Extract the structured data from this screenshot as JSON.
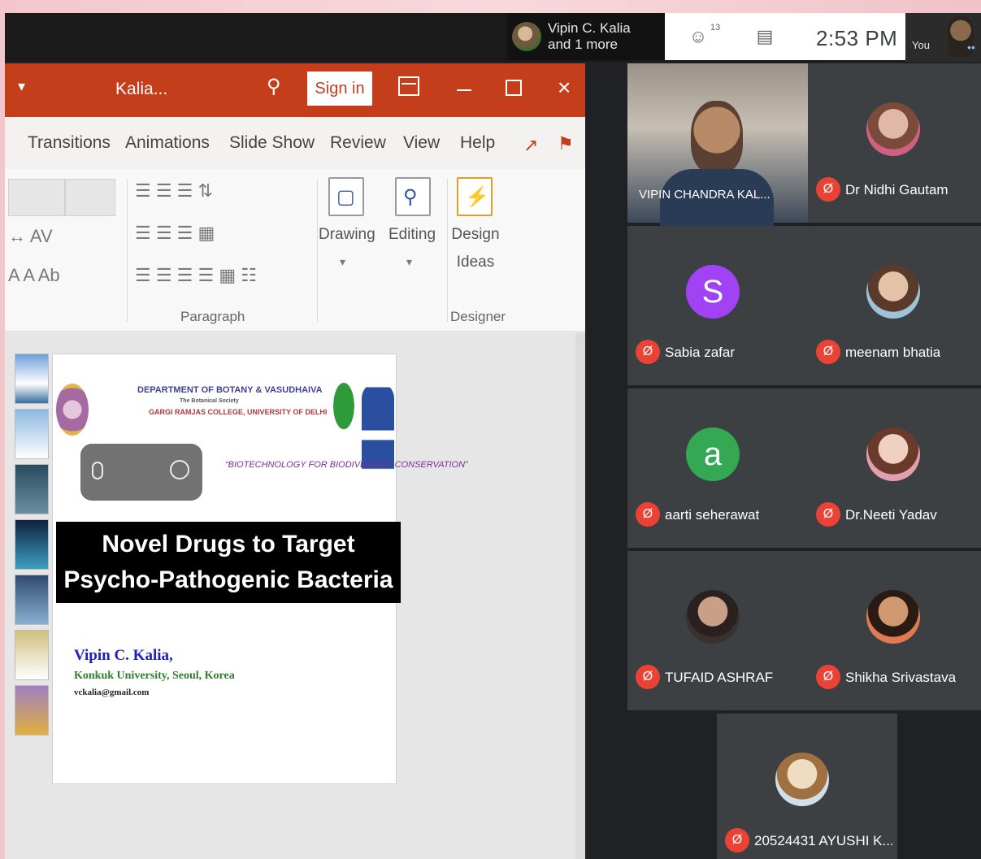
{
  "meet": {
    "presenter_line1": "Vipin C. Kalia",
    "presenter_line2": "and 1 more",
    "people_count": "13",
    "clock": "2:53 PM",
    "you_label": "You"
  },
  "ppt": {
    "doc_name": "Kalia...",
    "sign_in": "Sign in",
    "tabs": [
      "Transitions",
      "Animations",
      "Slide Show",
      "Review",
      "View",
      "Help"
    ],
    "groups": {
      "paragraph": "Paragraph",
      "drawing": "Drawing",
      "editing": "Editing",
      "design_ideas_1": "Design",
      "design_ideas_2": "Ideas",
      "designer": "Designer"
    },
    "slide": {
      "dept": "DEPARTMENT OF BOTANY & VASUDHAIVA",
      "sub1": "The Botanical Society",
      "college": "GARGI RAMJAS COLLEGE, UNIVERSITY OF DELHI",
      "conference": "“BIOTECHNOLOGY FOR BIODIVERSITY CONSERVATION”",
      "title_line1": "Novel Drugs to Target",
      "title_line2": "Psycho-Pathogenic Bacteria",
      "author": "Vipin C. Kalia,",
      "affiliation": "Konkuk University, Seoul, Korea",
      "email": "vckalia@gmail.com"
    }
  },
  "participants": [
    {
      "name": "VIPIN CHANDRA KAL...",
      "video": true
    },
    {
      "name": "Dr Nidhi Gautam",
      "avatar_color": "#c9a0a0",
      "photo": true
    },
    {
      "name": "Sabia zafar",
      "initial": "S",
      "avatar_color": "#a142f4"
    },
    {
      "name": "meenam bhatia",
      "avatar_color": "#d9c7b5",
      "photo": true
    },
    {
      "name": "aarti seherawat",
      "initial": "a",
      "avatar_color": "#34a853"
    },
    {
      "name": "Dr.Neeti Yadav",
      "avatar_color": "#e6c4c0",
      "photo": true
    },
    {
      "name": "TUFAID ASHRAF",
      "avatar_color": "#5a4a42",
      "photo": true
    },
    {
      "name": "Shikha Srivastava",
      "avatar_color": "#c98c4a",
      "photo": true
    },
    {
      "name": "20524431 AYUSHI K...",
      "avatar_color": "#e9d6b8",
      "photo": true
    }
  ]
}
